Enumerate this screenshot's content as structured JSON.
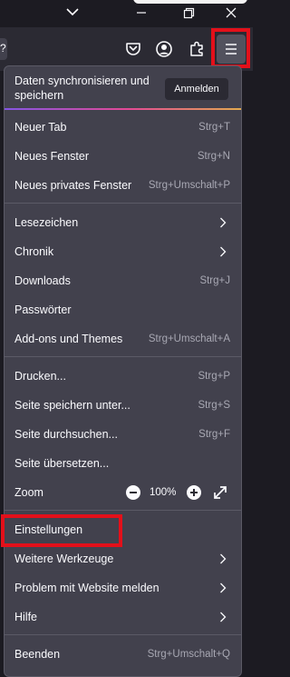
{
  "colors": {
    "titlebar": "#1c1b22",
    "toolbar": "#2b2a33",
    "panel": "#42414d",
    "text": "#fbfbfe",
    "shortcut": "#a8a8b3",
    "highlight": "#e3101a"
  },
  "toolbar": {
    "url_stub_text": "?",
    "icons": [
      "pocket-icon",
      "account-icon",
      "extensions-icon",
      "hamburger-menu-icon"
    ]
  },
  "menu": {
    "sync": {
      "text": "Daten synchronisieren und speichern",
      "button": "Anmelden"
    },
    "items": {
      "new_tab": {
        "label": "Neuer Tab",
        "shortcut": "Strg+T"
      },
      "new_window": {
        "label": "Neues Fenster",
        "shortcut": "Strg+N"
      },
      "private_window": {
        "label": "Neues privates Fenster",
        "shortcut": "Strg+Umschalt+P"
      },
      "bookmarks": {
        "label": "Lesezeichen"
      },
      "history": {
        "label": "Chronik"
      },
      "downloads": {
        "label": "Downloads",
        "shortcut": "Strg+J"
      },
      "passwords": {
        "label": "Passwörter"
      },
      "addons": {
        "label": "Add-ons und Themes",
        "shortcut": "Strg+Umschalt+A"
      },
      "print": {
        "label": "Drucken...",
        "shortcut": "Strg+P"
      },
      "save_page": {
        "label": "Seite speichern unter...",
        "shortcut": "Strg+S"
      },
      "find": {
        "label": "Seite durchsuchen...",
        "shortcut": "Strg+F"
      },
      "translate": {
        "label": "Seite übersetzen..."
      },
      "zoom": {
        "label": "Zoom",
        "value": "100%"
      },
      "settings": {
        "label": "Einstellungen"
      },
      "more_tools": {
        "label": "Weitere Werkzeuge"
      },
      "report": {
        "label": "Problem mit Website melden"
      },
      "help": {
        "label": "Hilfe"
      },
      "quit": {
        "label": "Beenden",
        "shortcut": "Strg+Umschalt+Q"
      }
    }
  }
}
